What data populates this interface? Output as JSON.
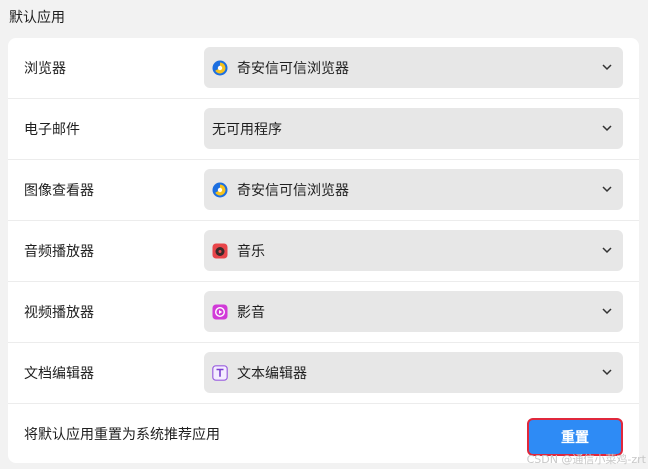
{
  "section": {
    "title": "默认应用"
  },
  "rows": [
    {
      "label": "浏览器",
      "value": "奇安信可信浏览器",
      "icon": "qianxin-browser-icon"
    },
    {
      "label": "电子邮件",
      "value": "无可用程序",
      "icon": ""
    },
    {
      "label": "图像查看器",
      "value": "奇安信可信浏览器",
      "icon": "qianxin-browser-icon"
    },
    {
      "label": "音频播放器",
      "value": "音乐",
      "icon": "music-icon"
    },
    {
      "label": "视频播放器",
      "value": "影音",
      "icon": "movie-icon"
    },
    {
      "label": "文档编辑器",
      "value": "文本编辑器",
      "icon": "text-editor-icon"
    }
  ],
  "reset": {
    "description": "将默认应用重置为系统推荐应用",
    "button_label": "重置"
  },
  "watermark": "CSDN @通信小菜鸡-zrt",
  "colors": {
    "accent": "#2e8bf5",
    "highlight_border": "#e0283c",
    "card": "#ffffff",
    "background": "#f2f2f2",
    "select_bg": "#e7e7e7"
  }
}
